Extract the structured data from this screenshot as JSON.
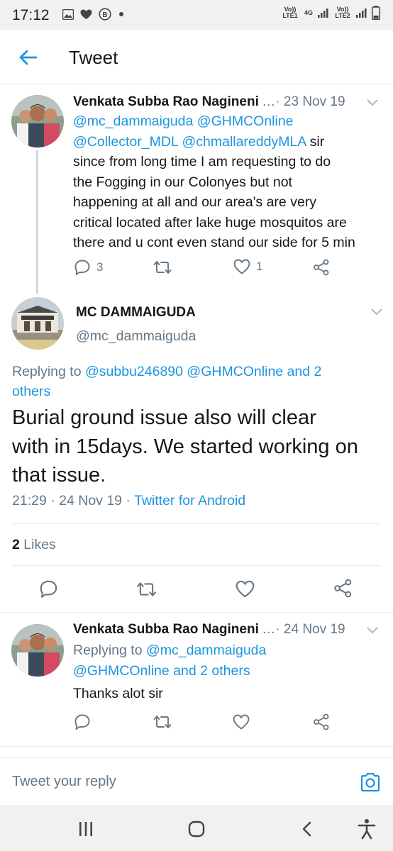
{
  "status_bar": {
    "time": "17:12",
    "sim1": "Vo)) LTE1",
    "network": "4G",
    "sim2": "Vo)) LTE2"
  },
  "header": {
    "title": "Tweet"
  },
  "tweet1": {
    "name": "Venkata Subba Rao Nagineni",
    "ellipsis": "…",
    "date": "· 23 Nov 19",
    "mentions_line1": "@mc_dammaiguda @GHMCOnline",
    "mentions_line2": "@Collector_MDL @chmallareddyMLA",
    "text_line2_rest": " sir",
    "text_line3": "since from long time I am requesting to do",
    "text_line4": "the Fogging in our Colonyes but not",
    "text_line5": "happening at all and our area's are very",
    "text_line6": "critical located  after lake huge mosquitos are",
    "text_line7": "there and u cont even stand our side for 5 min",
    "reply_count": "3",
    "like_count": "1"
  },
  "main_tweet": {
    "name": "MC DAMMAIGUDA",
    "handle": "@mc_dammaiguda",
    "replying_prefix": "Replying to ",
    "replying_to": "@subbu246890 @GHMCOnline and 2",
    "replying_to_2": "others",
    "text_line1": "Burial ground issue also will clear",
    "text_line2": "with in 15days. We started working on",
    "text_line3": "that issue.",
    "timestamp": "21:29 · 24 Nov 19 · ",
    "source": "Twitter for Android",
    "likes_count": "2",
    "likes_label": " Likes"
  },
  "tweet3": {
    "name": "Venkata Subba Rao Nagineni",
    "ellipsis": "…",
    "date": "· 24 Nov 19",
    "replying_prefix": "Replying to ",
    "replying_to": "@mc_dammaiguda",
    "replying_to_2": "@GHMCOnline and 2 others",
    "text": "Thanks alot sir"
  },
  "reply_box": {
    "placeholder": "Tweet your reply"
  },
  "colors": {
    "accent": "#1b95e0",
    "secondary_text": "#657786",
    "divider": "#e6ecf0"
  }
}
